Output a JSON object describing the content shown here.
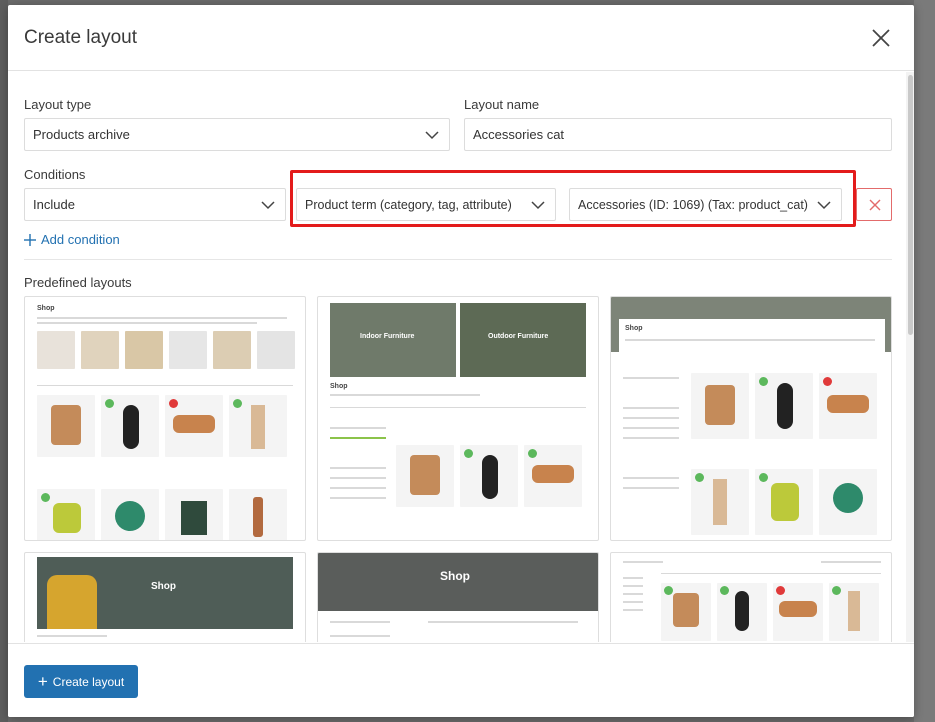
{
  "modal": {
    "title": "Create layout",
    "create_label": "Create layout"
  },
  "form": {
    "layout_type_label": "Layout type",
    "layout_type_value": "Products archive",
    "layout_name_label": "Layout name",
    "layout_name_value": "Accessories cat",
    "conditions_label": "Conditions",
    "condition_mode": "Include",
    "condition_source": "Product term (category, tag, attribute)",
    "condition_term": "Accessories (ID: 1069) (Tax: product_cat)",
    "add_condition_label": "Add condition"
  },
  "predefined": {
    "title": "Predefined layouts",
    "cards": [
      {
        "heading": "Shop"
      },
      {
        "heading": "Shop",
        "banner_left": "Indoor Furniture",
        "banner_right": "Outdoor Furniture"
      },
      {
        "heading": "Shop"
      },
      {
        "heading": "Shop"
      },
      {
        "heading": "Shop"
      },
      {
        "heading": ""
      }
    ]
  },
  "colors": {
    "accent": "#2271b1",
    "highlight": "#e31b1b",
    "danger": "#e36b6b"
  },
  "icons": [
    "close-icon",
    "chevron-down-icon",
    "plus-icon",
    "remove-icon"
  ]
}
